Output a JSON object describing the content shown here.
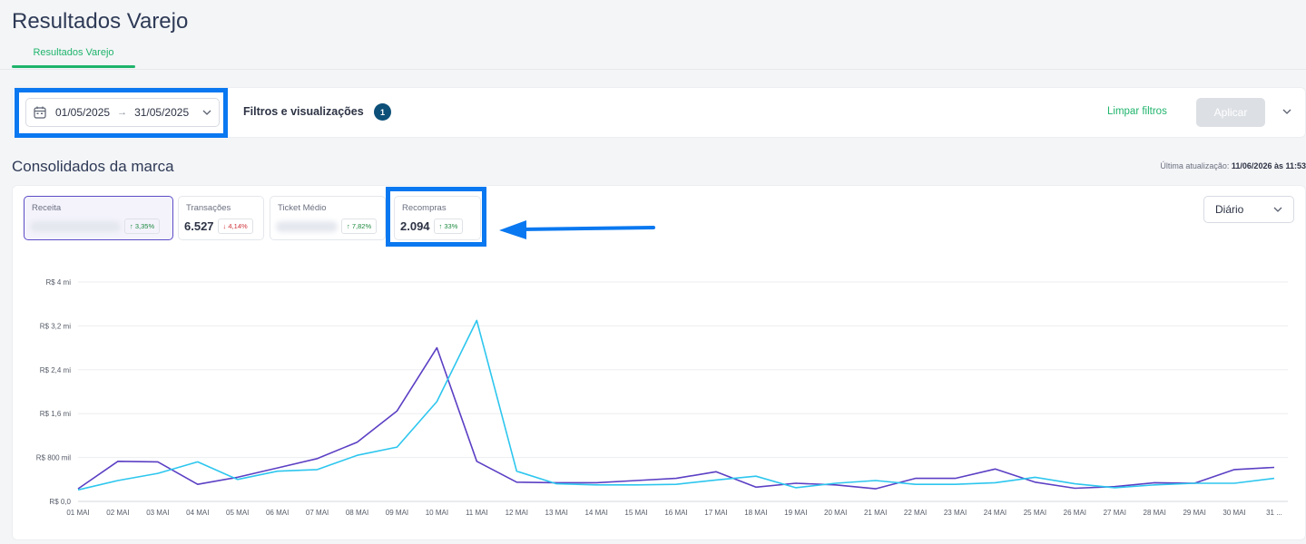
{
  "header": {
    "title": "Resultados Varejo",
    "tab": "Resultados Varejo"
  },
  "filters": {
    "date_start": "01/05/2025",
    "date_end": "31/05/2025",
    "label": "Filtros e visualizações",
    "badge_count": "1",
    "clear_label": "Limpar filtros",
    "apply_label": "Aplicar"
  },
  "section": {
    "title": "Consolidados da marca",
    "updated_prefix": "Última atualização:",
    "updated_value": "11/06/2026 às 11:53"
  },
  "kpis": [
    {
      "label": "Receita",
      "value": "",
      "delta": "3,35%",
      "direction": "up"
    },
    {
      "label": "Transações",
      "value": "6.527",
      "delta": "4,14%",
      "direction": "down"
    },
    {
      "label": "Ticket Médio",
      "value": "",
      "delta": "7,82%",
      "direction": "up"
    },
    {
      "label": "Recompras",
      "value": "2.094",
      "delta": "33%",
      "direction": "up"
    }
  ],
  "period_select": {
    "value": "Diário"
  },
  "colors": {
    "series_a": "#5b3fc4",
    "series_b": "#2dc6ee",
    "accent": "#1fb46c",
    "annotation": "#0a78f0"
  },
  "chart_data": {
    "type": "line",
    "categories": [
      "01 MAI",
      "02 MAI",
      "03 MAI",
      "04 MAI",
      "05 MAI",
      "06 MAI",
      "07 MAI",
      "08 MAI",
      "09 MAI",
      "10 MAI",
      "11 MAI",
      "12 MAI",
      "13 MAI",
      "14 MAI",
      "15 MAI",
      "16 MAI",
      "17 MAI",
      "18 MAI",
      "19 MAI",
      "20 MAI",
      "21 MAI",
      "22 MAI",
      "23 MAI",
      "24 MAI",
      "25 MAI",
      "26 MAI",
      "27 MAI",
      "28 MAI",
      "29 MAI",
      "30 MAI",
      "31 ..."
    ],
    "y_ticks": [
      "R$ 0,0",
      "R$ 800 mil",
      "R$ 1,6 mi",
      "R$ 2,4 mi",
      "R$ 3,2 mi",
      "R$ 4 mi"
    ],
    "ylim": [
      0,
      4000
    ],
    "y_unit": "R$ mil",
    "grid": true,
    "series": [
      {
        "color": "#5b3fc4",
        "values": [
          230,
          730,
          720,
          310,
          440,
          610,
          780,
          1080,
          1650,
          2800,
          730,
          350,
          340,
          340,
          380,
          420,
          540,
          260,
          330,
          300,
          230,
          420,
          420,
          590,
          350,
          240,
          270,
          340,
          330,
          580,
          620
        ]
      },
      {
        "color": "#2dc6ee",
        "values": [
          210,
          380,
          510,
          720,
          400,
          550,
          580,
          840,
          990,
          1820,
          3300,
          550,
          320,
          300,
          300,
          310,
          390,
          460,
          250,
          330,
          380,
          310,
          310,
          340,
          440,
          320,
          250,
          300,
          330,
          330,
          420
        ]
      }
    ]
  }
}
